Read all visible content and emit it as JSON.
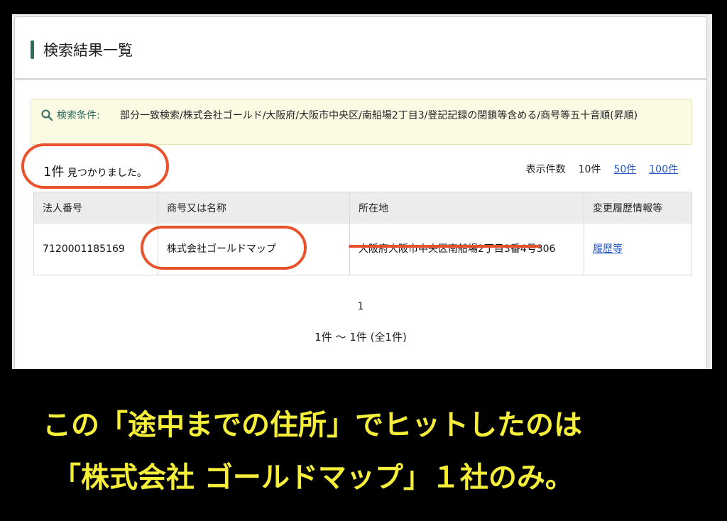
{
  "panel": {
    "title": "検索結果一覧"
  },
  "conditions": {
    "label": "検索条件:",
    "text": "部分一致検索/株式会社ゴールド/大阪府/大阪市中央区/南船場2丁目3/登記記録の閉鎖等含める/商号等五十音順(昇順)"
  },
  "results": {
    "count": "1件",
    "count_suffix": "見つかりました。",
    "perpage_label": "表示件数",
    "perpage_current": "10件",
    "perpage_options": [
      "50件",
      "100件"
    ]
  },
  "table": {
    "headers": [
      "法人番号",
      "商号又は名称",
      "所在地",
      "変更履歴情報等"
    ],
    "rows": [
      {
        "number": "7120001185169",
        "name": "株式会社ゴールドマップ",
        "address": "大阪府大阪市中央区南船場2丁目3番4号306",
        "history_link": "履歴等"
      }
    ]
  },
  "pager": {
    "page": "1",
    "range": "1件 ～ 1件 (全1件)"
  },
  "caption": {
    "line1": "この「途中までの住所」でヒットしたのは",
    "line2": "「株式会社 ゴールドマップ」１社のみ。"
  },
  "colors": {
    "accent": "#2f6b5e",
    "annotation": "#e8532d",
    "caption": "#f6ef3a",
    "link": "#2457c5"
  }
}
